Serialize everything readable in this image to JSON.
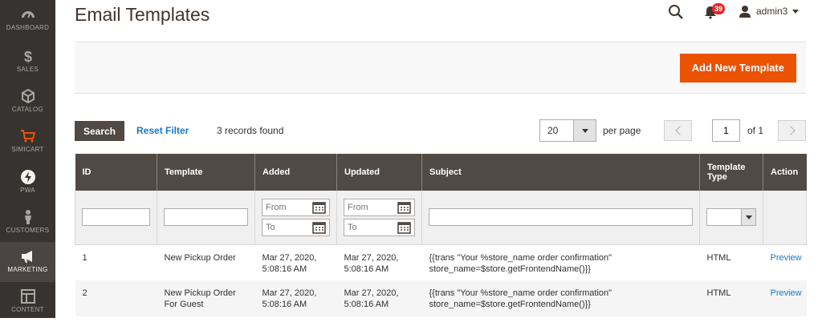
{
  "sidebar": {
    "items": [
      {
        "label": "DASHBOARD",
        "icon": "dashboard-icon"
      },
      {
        "label": "SALES",
        "icon": "dollar-icon"
      },
      {
        "label": "CATALOG",
        "icon": "cube-icon"
      },
      {
        "label": "SIMICART",
        "icon": "cart-icon"
      },
      {
        "label": "PWA",
        "icon": "bolt-icon"
      },
      {
        "label": "CUSTOMERS",
        "icon": "person-icon"
      },
      {
        "label": "MARKETING",
        "icon": "megaphone-icon"
      },
      {
        "label": "CONTENT",
        "icon": "layout-icon"
      }
    ]
  },
  "header": {
    "title": "Email Templates",
    "notifications_count": "39",
    "user_name": "admin3"
  },
  "actions": {
    "add_new_label": "Add New Template"
  },
  "toolbar": {
    "search_label": "Search",
    "reset_label": "Reset Filter",
    "records_text": "3 records found",
    "per_page_value": "20",
    "per_page_label": "per page",
    "current_page": "1",
    "of_pages": "of 1"
  },
  "table": {
    "columns": [
      "ID",
      "Template",
      "Added",
      "Updated",
      "Subject",
      "Template Type",
      "Action"
    ],
    "filters": {
      "from_placeholder": "From",
      "to_placeholder": "To"
    },
    "rows": [
      {
        "id": "1",
        "template": "New Pickup Order",
        "added": "Mar 27, 2020, 5:08:16 AM",
        "updated": "Mar 27, 2020, 5:08:16 AM",
        "subject": "{{trans \"Your %store_name order confirmation\" store_name=$store.getFrontendName()}}",
        "type": "HTML",
        "action": "Preview"
      },
      {
        "id": "2",
        "template": "New Pickup Order For Guest",
        "added": "Mar 27, 2020, 5:08:16 AM",
        "updated": "Mar 27, 2020, 5:08:16 AM",
        "subject": "{{trans \"Your %store_name order confirmation\" store_name=$store.getFrontendName()}}",
        "type": "HTML",
        "action": "Preview"
      }
    ]
  },
  "colors": {
    "sidebar_bg": "#373330",
    "accent": "#eb5202",
    "table_header": "#514943",
    "link": "#1979c3"
  }
}
